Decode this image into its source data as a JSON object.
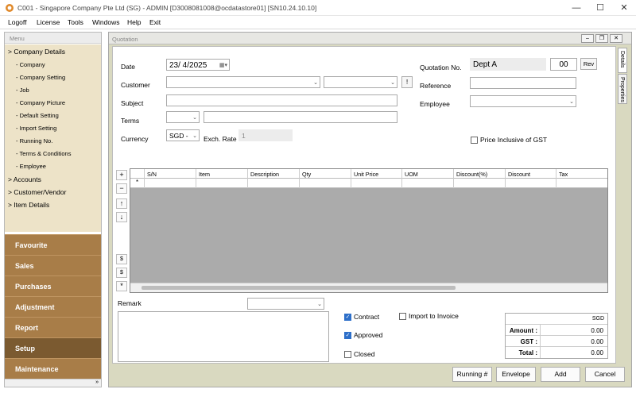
{
  "window": {
    "title": "C001 - Singapore Company Pte Ltd (SG) - ADMIN [D3008081008@ocdatastore01] [SN10.24.10.10]",
    "minimize": "—",
    "maximize": "☐",
    "close": "✕"
  },
  "menubar": [
    "Logoff",
    "License",
    "Tools",
    "Windows",
    "Help",
    "Exit"
  ],
  "sidebar": {
    "header": "Menu",
    "company_details": "> Company Details",
    "company_items": [
      "- Company",
      "- Company Setting",
      "- Job",
      "- Company Picture",
      "- Default Setting",
      "- Import Setting",
      "- Running No.",
      "- Terms & Conditions",
      "- Employee"
    ],
    "accounts": "> Accounts",
    "customer_vendor": "> Customer/Vendor",
    "item_details": "> Item Details",
    "sections": [
      "Favourite",
      "Sales",
      "Purchases",
      "Adjustment",
      "Report",
      "Setup",
      "Maintenance"
    ],
    "active_section": "Setup"
  },
  "quotation": {
    "title": "Quotation",
    "date_label": "Date",
    "date_value": "23/  4/2025",
    "customer_label": "Customer",
    "customer_value": "",
    "customer2_value": "",
    "subject_label": "Subject",
    "terms_label": "Terms",
    "currency_label": "Currency",
    "currency_value": "SGD -",
    "exch_rate_label": "Exch. Rate",
    "exch_rate_value": "1",
    "quotation_no_label": "Quotation No.",
    "quotation_dept": "Dept A",
    "quotation_seq": "00",
    "rev_button": "Rev",
    "reference_label": "Reference",
    "employee_label": "Employee",
    "price_inclusive_label": "Price Inclusive of GST",
    "ellipsis_button": "!",
    "tabs": [
      "Details",
      "Properties"
    ]
  },
  "grid": {
    "columns": [
      "S/N",
      "Item",
      "Description",
      "Qty",
      "Unit Price",
      "UOM",
      "Discount(%)",
      "Discount",
      "Tax"
    ],
    "new_row_marker": "*",
    "side_buttons": [
      "+",
      "−",
      "↑",
      "↓",
      "$",
      "$",
      "*"
    ]
  },
  "remark": {
    "label": "Remark"
  },
  "checkboxes": {
    "contract": {
      "label": "Contract",
      "checked": true
    },
    "import_to_invoice": {
      "label": "Import to Invoice",
      "checked": false
    },
    "approved": {
      "label": "Approved",
      "checked": true
    },
    "closed": {
      "label": "Closed",
      "checked": false
    }
  },
  "totals": {
    "currency": "SGD",
    "amount_label": "Amount :",
    "amount_value": "0.00",
    "gst_label": "GST :",
    "gst_value": "0.00",
    "total_label": "Total :",
    "total_value": "0.00"
  },
  "buttons": {
    "running": "Running #",
    "envelope": "Envelope",
    "add": "Add",
    "cancel": "Cancel"
  },
  "colors": {
    "section_bg": "#a87d48",
    "section_active": "#7b5a30",
    "tree_bg": "#ede3c8",
    "checkbox_checked": "#2d6fc9"
  }
}
